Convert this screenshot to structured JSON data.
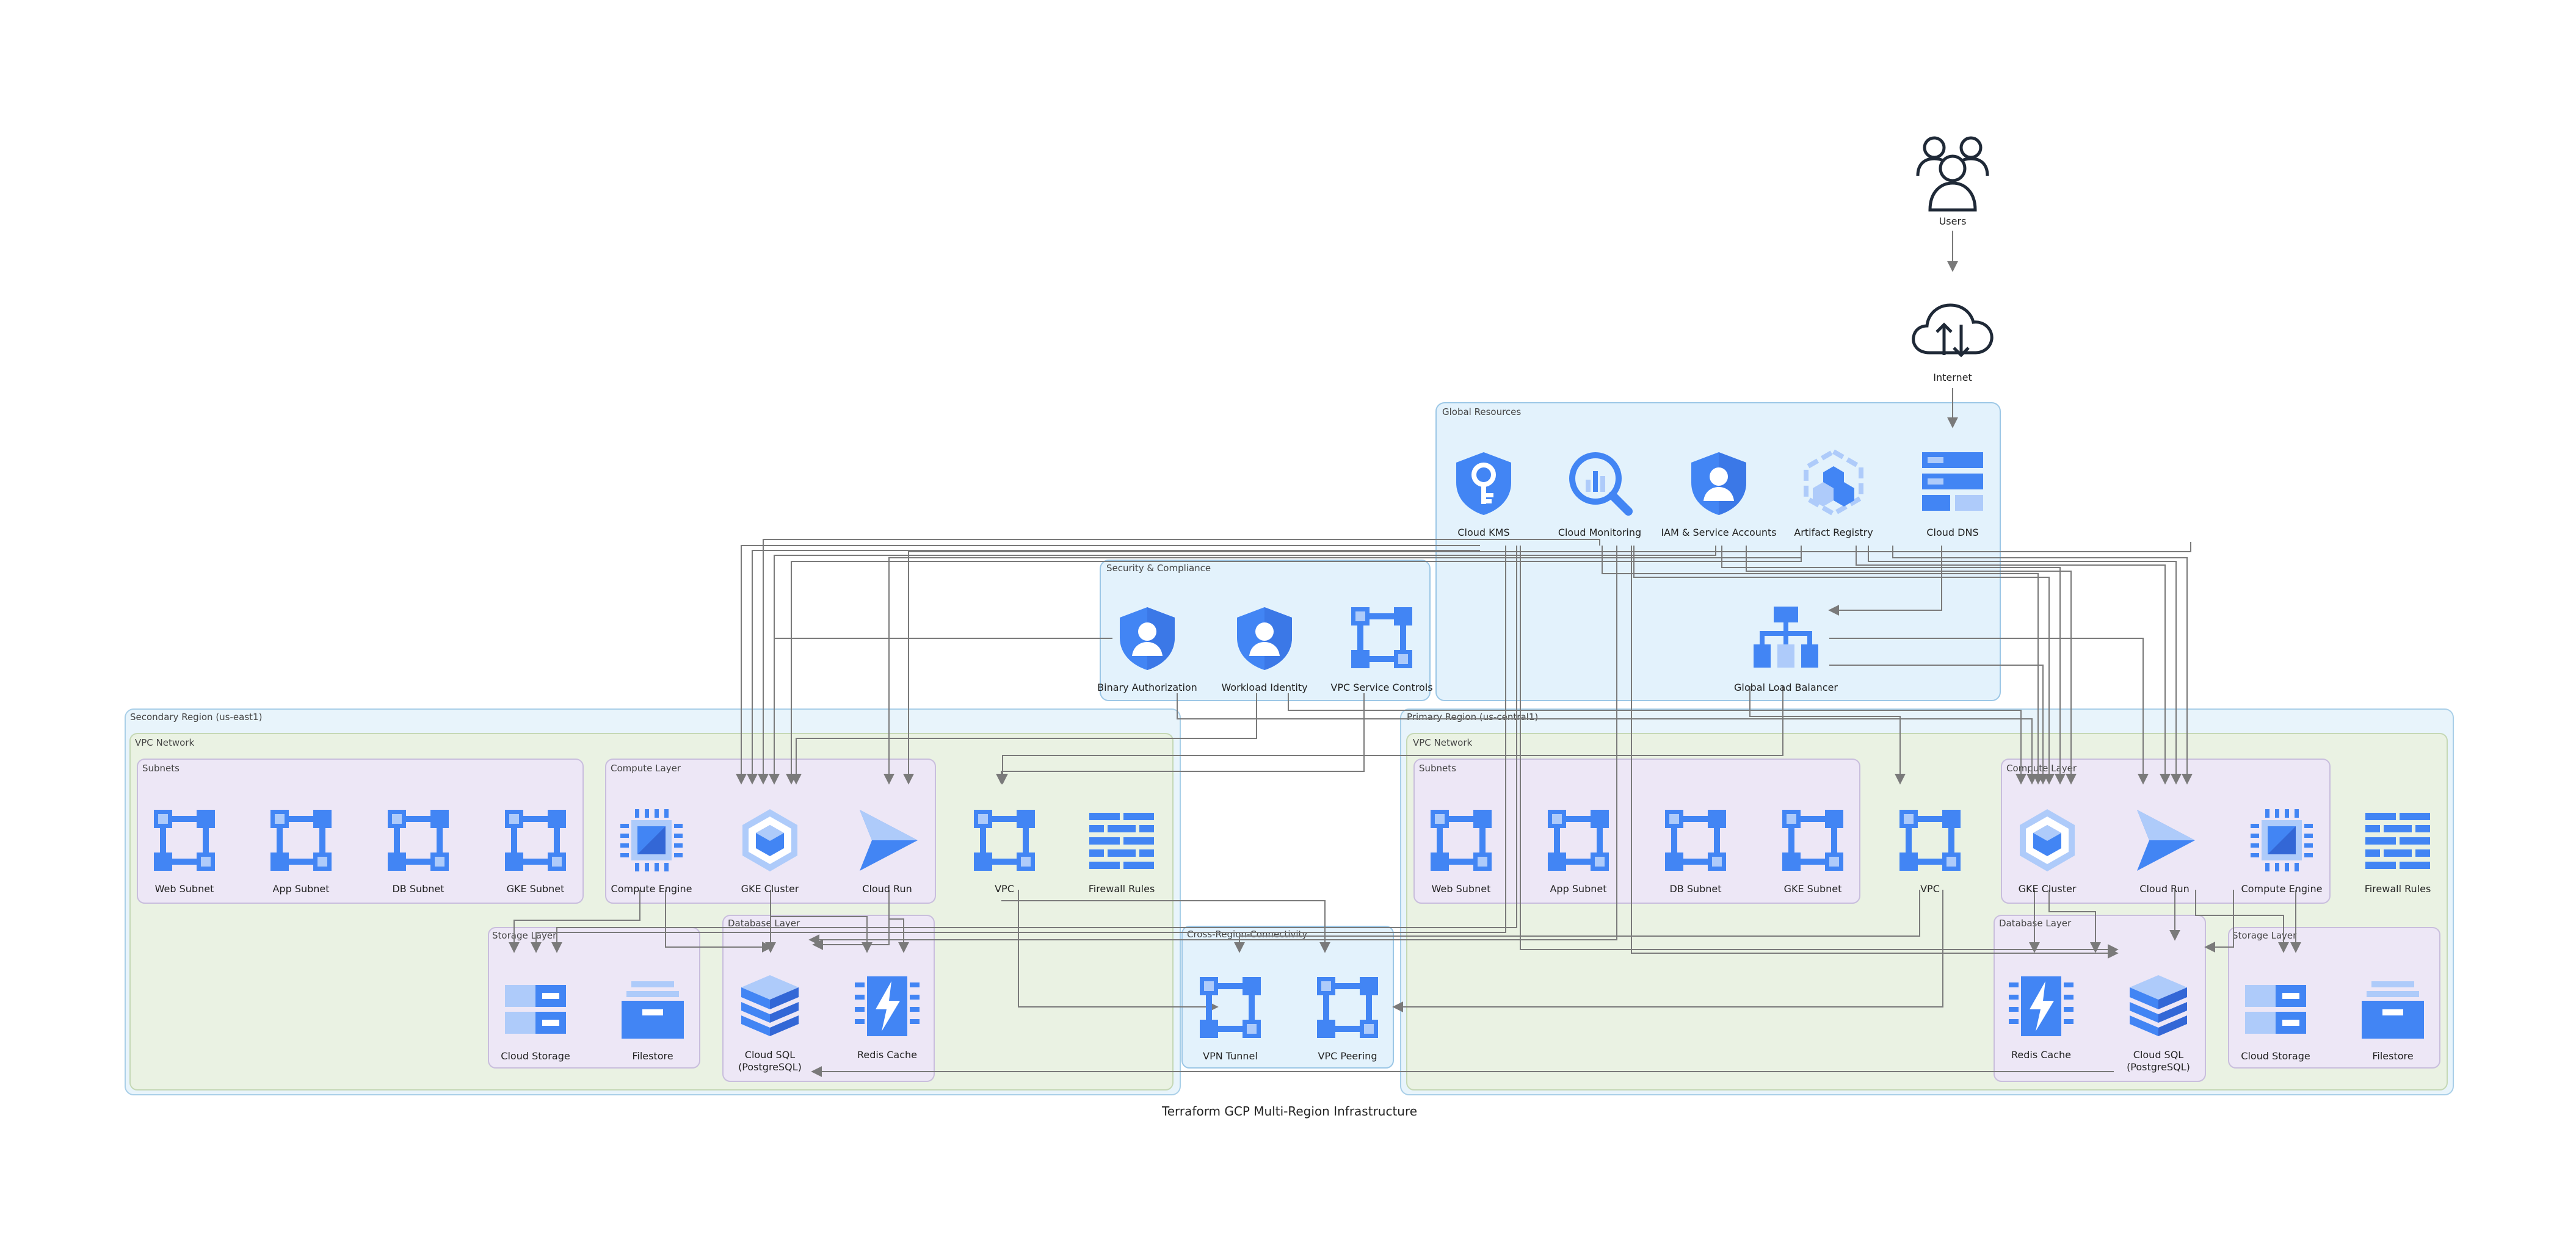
{
  "title": "Terraform GCP Multi-Region Infrastructure",
  "colors": {
    "global_fill": "#e3f2fc",
    "global_stroke": "#9cc7e6",
    "region_fill": "#e8f4fb",
    "region_stroke": "#a9cfe8",
    "vpc_fill": "#eaf2e3",
    "vpc_stroke": "#c5d8b5",
    "layer_fill": "#ede7f6",
    "layer_stroke": "#c9bedd",
    "icon_blue": "#4285f4",
    "icon_light": "#aecbfa",
    "edge": "#7a7a7a"
  },
  "clusters": {
    "global": "Global Resources",
    "security": "Security & Compliance",
    "secondary_region": "Secondary Region (us-east1)",
    "secondary_vpc": "VPC Network",
    "secondary_subnets": "Subnets",
    "secondary_compute": "Compute Layer",
    "secondary_storage": "Storage Layer",
    "secondary_database": "Database Layer",
    "cross_region": "Cross-Region-Connectivity",
    "primary_region": "Primary Region (us-central1)",
    "primary_vpc": "VPC Network",
    "primary_subnets": "Subnets",
    "primary_compute": "Compute Layer",
    "primary_storage": "Storage Layer",
    "primary_database": "Database Layer"
  },
  "nodes": {
    "users": {
      "label": "Users",
      "icon": "users-icon"
    },
    "internet": {
      "label": "Internet",
      "icon": "cloud-upload-download-icon"
    },
    "cloud_kms": {
      "label": "Cloud KMS",
      "icon": "shield-key-icon"
    },
    "cloud_monitoring": {
      "label": "Cloud Monitoring",
      "icon": "magnifier-chart-icon"
    },
    "iam": {
      "label": "IAM & Service Accounts",
      "icon": "shield-person-icon"
    },
    "artifact_registry": {
      "label": "Artifact Registry",
      "icon": "hexagon-cubes-icon"
    },
    "cloud_dns": {
      "label": "Cloud DNS",
      "icon": "dns-servers-icon"
    },
    "global_lb": {
      "label": "Global Load Balancer",
      "icon": "load-balancer-icon"
    },
    "binary_auth": {
      "label": "Binary Authorization",
      "icon": "shield-person-icon"
    },
    "workload_identity": {
      "label": "Workload Identity",
      "icon": "shield-person-icon"
    },
    "vpc_sc": {
      "label": "VPC Service Controls",
      "icon": "network-square-icon"
    },
    "s_web_subnet": {
      "label": "Web Subnet",
      "icon": "network-square-icon"
    },
    "s_app_subnet": {
      "label": "App Subnet",
      "icon": "network-square-icon"
    },
    "s_db_subnet": {
      "label": "DB Subnet",
      "icon": "network-square-icon"
    },
    "s_gke_subnet": {
      "label": "GKE Subnet",
      "icon": "network-square-icon"
    },
    "s_compute_engine": {
      "label": "Compute Engine",
      "icon": "cpu-chip-icon"
    },
    "s_gke_cluster": {
      "label": "GKE Cluster",
      "icon": "hexagon-cube-icon"
    },
    "s_cloud_run": {
      "label": "Cloud Run",
      "icon": "cloud-run-icon"
    },
    "s_vpc": {
      "label": "VPC",
      "icon": "network-square-icon"
    },
    "s_firewall": {
      "label": "Firewall Rules",
      "icon": "firewall-icon"
    },
    "s_cloud_storage": {
      "label": "Cloud Storage",
      "icon": "storage-drives-icon"
    },
    "s_filestore": {
      "label": "Filestore",
      "icon": "filestore-box-icon"
    },
    "s_cloud_sql": {
      "label": "Cloud SQL",
      "label2": "(PostgreSQL)",
      "icon": "database-stack-icon"
    },
    "s_redis": {
      "label": "Redis Cache",
      "icon": "redis-bolt-icon"
    },
    "vpn_tunnel": {
      "label": "VPN Tunnel",
      "icon": "network-square-icon"
    },
    "vpc_peering": {
      "label": "VPC Peering",
      "icon": "network-square-icon"
    },
    "p_web_subnet": {
      "label": "Web Subnet",
      "icon": "network-square-icon"
    },
    "p_app_subnet": {
      "label": "App Subnet",
      "icon": "network-square-icon"
    },
    "p_db_subnet": {
      "label": "DB Subnet",
      "icon": "network-square-icon"
    },
    "p_gke_subnet": {
      "label": "GKE Subnet",
      "icon": "network-square-icon"
    },
    "p_vpc": {
      "label": "VPC",
      "icon": "network-square-icon"
    },
    "p_gke_cluster": {
      "label": "GKE Cluster",
      "icon": "hexagon-cube-icon"
    },
    "p_cloud_run": {
      "label": "Cloud Run",
      "icon": "cloud-run-icon"
    },
    "p_compute_engine": {
      "label": "Compute Engine",
      "icon": "cpu-chip-icon"
    },
    "p_firewall": {
      "label": "Firewall Rules",
      "icon": "firewall-icon"
    },
    "p_redis": {
      "label": "Redis Cache",
      "icon": "redis-bolt-icon"
    },
    "p_cloud_sql": {
      "label": "Cloud SQL",
      "label2": "(PostgreSQL)",
      "icon": "database-stack-icon"
    },
    "p_cloud_storage": {
      "label": "Cloud Storage",
      "icon": "storage-drives-icon"
    },
    "p_filestore": {
      "label": "Filestore",
      "icon": "filestore-box-icon"
    }
  }
}
